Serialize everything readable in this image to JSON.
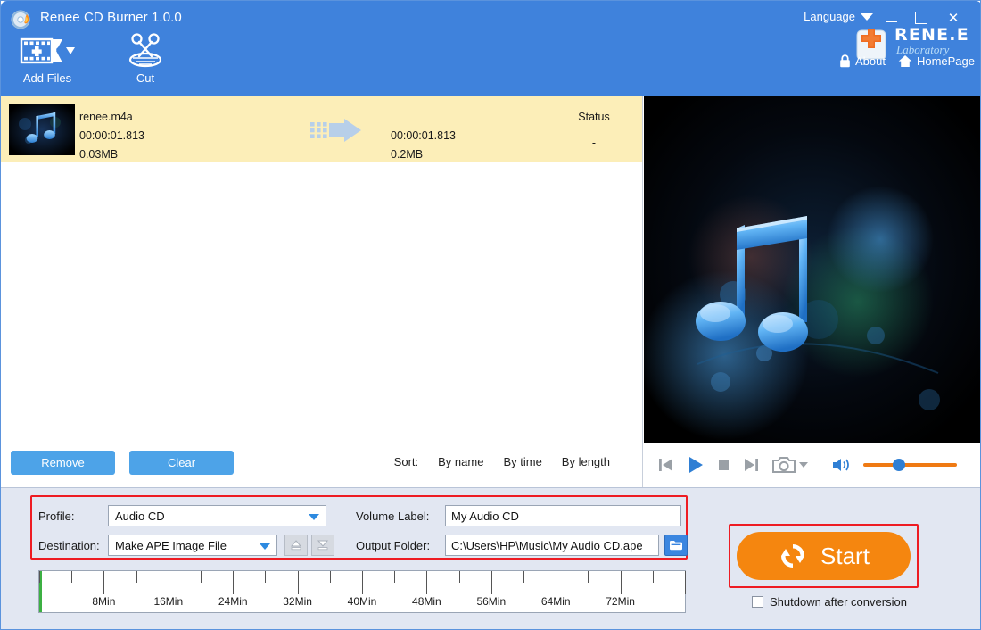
{
  "window": {
    "title": "Renee CD Burner 1.0.0",
    "app_icon": "cd-flame-icon",
    "minimize_label": "Minimize",
    "maximize_label": "Maximize",
    "close_label": "Close",
    "close_glyph": "✕"
  },
  "toolbar": {
    "buttons": [
      {
        "label": "Add Files",
        "icon": "add-files-icon",
        "has_dropdown": true
      },
      {
        "label": "Cut",
        "icon": "scissors-icon",
        "has_dropdown": false
      }
    ]
  },
  "header_right": {
    "language_label": "Language",
    "brand_name": "RENE.E",
    "brand_sub": "Laboratory",
    "about_label": "About",
    "homepage_label": "HomePage",
    "about_icon": "lock-icon",
    "homepage_icon": "home-icon"
  },
  "file_list": {
    "status_header": "Status",
    "rows": [
      {
        "name": "renee.m4a",
        "duration": "00:00:01.813",
        "size": "0.03MB",
        "out_duration": "00:00:01.813",
        "out_size": "0.2MB",
        "status": "-",
        "thumb_icon": "music-note-thumb"
      }
    ]
  },
  "list_toolbar": {
    "remove_label": "Remove",
    "clear_label": "Clear",
    "sort_label": "Sort:",
    "sort_options": [
      "By name",
      "By time",
      "By length"
    ]
  },
  "preview": {
    "artwork": "music-note-artwork"
  },
  "player": {
    "prev_icon": "skip-previous-icon",
    "play_icon": "play-icon",
    "stop_icon": "stop-icon",
    "next_icon": "skip-next-icon",
    "snapshot_icon": "camera-icon",
    "volume_icon": "volume-icon",
    "volume_percent": 38
  },
  "settings": {
    "profile_label": "Profile:",
    "profile_value": "Audio CD",
    "destination_label": "Destination:",
    "destination_value": "Make APE Image File",
    "eject_icon": "eject-icon",
    "load_icon": "load-icon",
    "volume_label_label": "Volume Label:",
    "volume_label_value": "My Audio CD",
    "output_folder_label": "Output Folder:",
    "output_folder_value": "C:\\Users\\HP\\Music\\My Audio CD.ape",
    "browse_icon": "folder-icon"
  },
  "ruler": {
    "labels": [
      "8Min",
      "16Min",
      "24Min",
      "32Min",
      "40Min",
      "48Min",
      "56Min",
      "64Min",
      "72Min"
    ],
    "max_minutes": 80,
    "major_step_minutes": 8,
    "minor_step_minutes": 4
  },
  "action": {
    "start_label": "Start",
    "start_icon": "refresh-icon",
    "shutdown_label": "Shutdown after conversion",
    "shutdown_checked": false
  },
  "colors": {
    "titlebar": "#3f82dc",
    "accent_blue": "#4da3e8",
    "panel": "#e2e7f2",
    "row_highlight": "#fceeb8",
    "start_orange": "#f5860f",
    "highlight_box": "#ee1c23",
    "volume_track": "#ef7a13",
    "ruler_marker": "#3cb043"
  }
}
